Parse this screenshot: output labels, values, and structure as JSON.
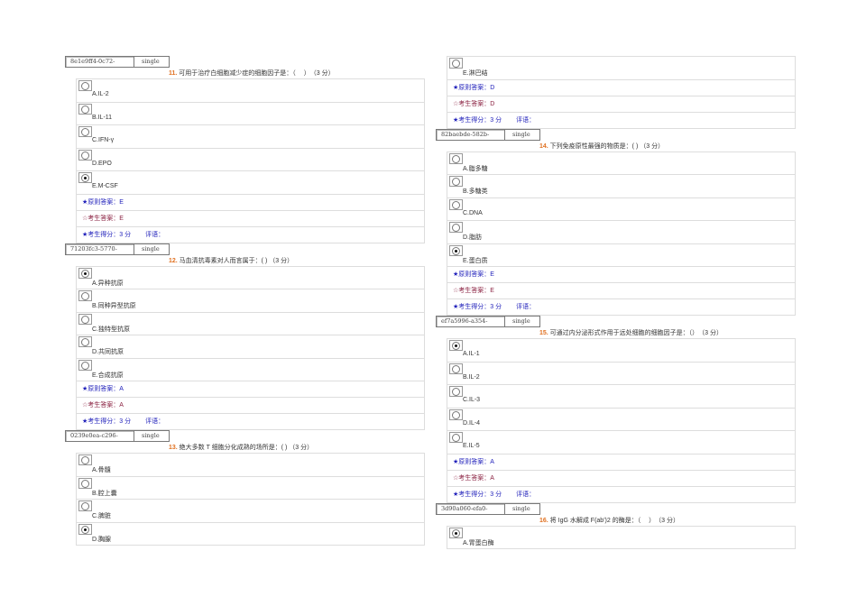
{
  "columns": [
    {
      "blocks": [
        {
          "id": "8e1e9ff4-0c72-",
          "type": "single",
          "num": "11.",
          "text": " 可用于治疗白细胞减少症的细胞因子是：（　 ）　（3 分）",
          "options": [
            {
              "label": "A.IL-2",
              "checked": false
            },
            {
              "label": "B.IL-11",
              "checked": false
            },
            {
              "label": "C.IFN-γ",
              "checked": false
            },
            {
              "label": "D.EPO",
              "checked": false
            },
            {
              "label": "E.M-CSF",
              "checked": true
            }
          ],
          "standard": "★原则答案：E",
          "student": "☆考生答案：E",
          "score": "★考生得分：3 分",
          "comment": "评语："
        },
        {
          "id": "71203fc3-5770-",
          "type": "single",
          "num": "12.",
          "text": " 马血清抗毒素对人而言属于：( ) （3 分）",
          "options": [
            {
              "label": "A.异种抗原",
              "checked": true
            },
            {
              "label": "B.同种异型抗原",
              "checked": false
            },
            {
              "label": "C.独特型抗原",
              "checked": false
            },
            {
              "label": "D.共同抗原",
              "checked": false
            },
            {
              "label": "E.合成抗原",
              "checked": false
            }
          ],
          "standard": "★原则答案：A",
          "student": "☆考生答案：A",
          "score": "★考生得分：3 分",
          "comment": "评语："
        },
        {
          "id": "0239e0ea-c296-",
          "type": "single",
          "num": "13.",
          "text": " 绝大多数 T 细胞分化成熟的场所是：( ) （3 分）",
          "options": [
            {
              "label": "A.骨髓",
              "checked": false
            },
            {
              "label": "B.腔上囊",
              "checked": false
            },
            {
              "label": "C.脾脏",
              "checked": false
            },
            {
              "label": "D.胸腺",
              "checked": true
            }
          ]
        }
      ]
    },
    {
      "blocks": [
        {
          "continuation": true,
          "options": [
            {
              "label": "E.淋巴结",
              "checked": false
            }
          ],
          "standard": "★原则答案：D",
          "student": "☆考生答案：D",
          "score": "★考生得分：3 分",
          "comment": "评语："
        },
        {
          "id": "82baebde-582b-",
          "type": "single",
          "num": "14.",
          "text": " 下列免疫原性最强的物质是：( ) （3 分）",
          "options": [
            {
              "label": "A.脂多糖",
              "checked": false
            },
            {
              "label": "B.多糖类",
              "checked": false
            },
            {
              "label": "C.DNA",
              "checked": false
            },
            {
              "label": "D.脂肪",
              "checked": false
            },
            {
              "label": "E.蛋白质",
              "checked": true
            }
          ],
          "standard": "★原则答案：E",
          "student": "☆考生答案：E",
          "score": "★考生得分：3 分",
          "comment": "评语："
        },
        {
          "id": "ef7a5996-a354-",
          "type": "single",
          "num": "15.",
          "text": " 可通过内分泌形式作用于远处细胞的细胞因子是：（）　（3 分）",
          "options": [
            {
              "label": "A.IL-1",
              "checked": true
            },
            {
              "label": "B.IL-2",
              "checked": false
            },
            {
              "label": "C.IL-3",
              "checked": false
            },
            {
              "label": "D.IL-4",
              "checked": false
            },
            {
              "label": "E.IL-5",
              "checked": false
            }
          ],
          "standard": "★原则答案：A",
          "student": "☆考生答案：A",
          "score": "★考生得分：3 分",
          "comment": "评语："
        },
        {
          "id": "3d90a060-efa0-",
          "type": "single",
          "num": "16.",
          "text": " 将 IgG 水解成 F(ab')2 的酶是：（　 ）　（3 分）",
          "options": [
            {
              "label": "A.胃蛋白酶",
              "checked": true
            }
          ]
        }
      ]
    }
  ]
}
